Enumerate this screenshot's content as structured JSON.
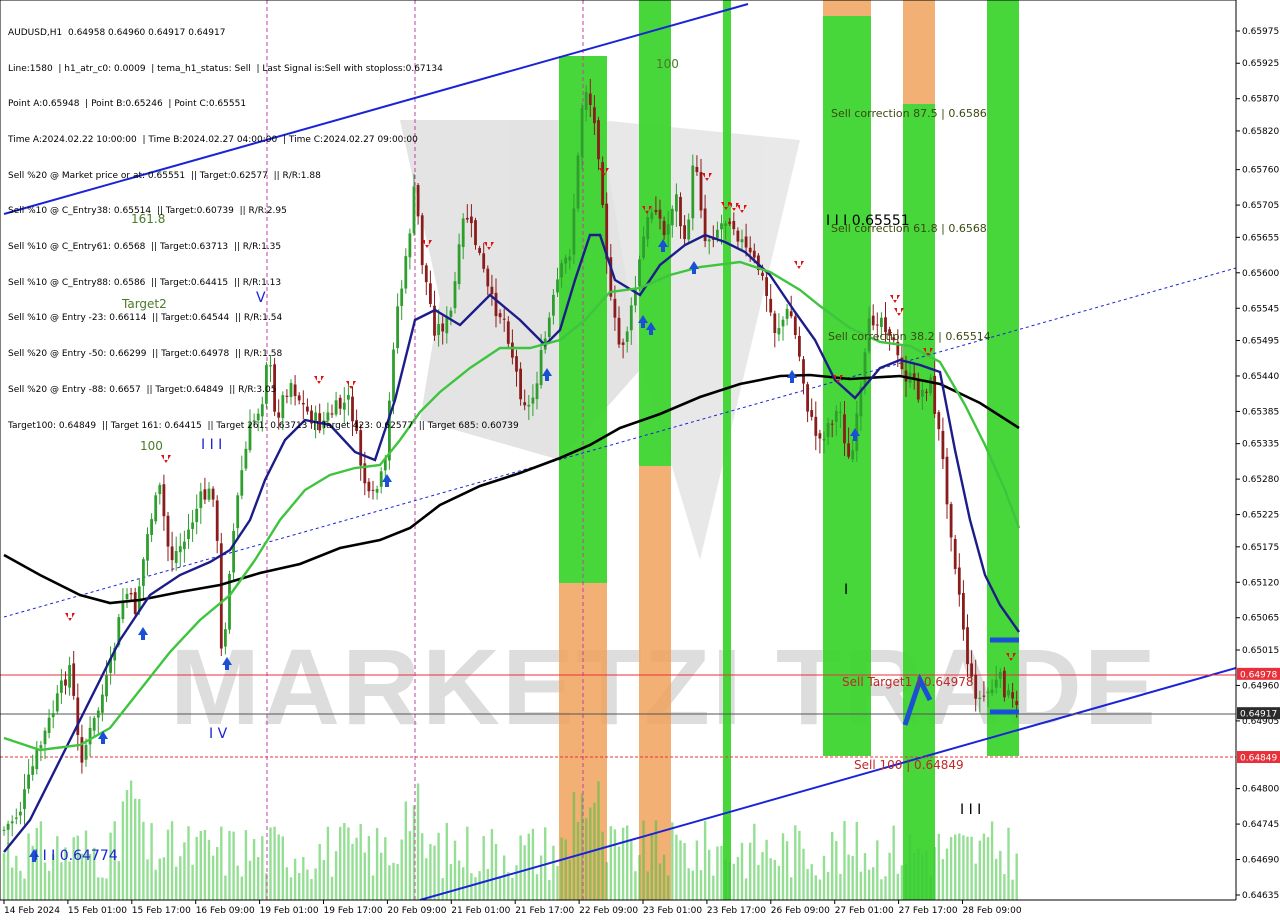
{
  "header": {
    "symbol_line": "AUDUSD,H1  0.64958 0.64960 0.64917 0.64917",
    "lines": [
      "Line:1580  | h1_atr_c0: 0.0009  | tema_h1_status: Sell  | Last Signal is:Sell with stoploss:0.67134",
      "Point A:0.65948  | Point B:0.65246  | Point C:0.65551",
      "Time A:2024.02.22 10:00:00  | Time B:2024.02.27 04:00:00  | Time C:2024.02.27 09:00:00",
      "Sell %20 @ Market price or at: 0.65551  || Target:0.62577  || R/R:1.88",
      "Sell %10 @ C_Entry38: 0.65514  || Target:0.60739  || R/R:2.95",
      "Sell %10 @ C_Entry61: 0.6568  || Target:0.63713  || R/R:1.35",
      "Sell %10 @ C_Entry88: 0.6586  || Target:0.64415  || R/R:1.13",
      "Sell %10 @ Entry -23: 0.66114  || Target:0.64544  || R/R:1.54",
      "Sell %20 @ Entry -50: 0.66299  || Target:0.64978  || R/R:1.58",
      "Sell %20 @ Entry -88: 0.6657  || Target:0.64849  || R/R:3.05",
      "Target100: 0.64849  || Target 161: 0.64415  || Target 261: 0.63713  || Target 423: 0.62577  || Target 685: 0.60739"
    ]
  },
  "watermark": "MARKETZI TRADE",
  "labels": {
    "t161": "161.8",
    "t2": "Target2",
    "t100a": "100",
    "t100b": "100",
    "III_a": "I I I",
    "V": "V",
    "IV": "I V",
    "III_b": "I I I",
    "I_mark": "I",
    "c_label": "I I I 0.65551",
    "start_label": "I I I 0.64774",
    "sell_corr_875": "Sell correction 87.5 | 0.6586",
    "sell_corr_618": "Sell correction 61.8 | 0.6568",
    "sell_corr_382": "Sell correction 38.2 | 0.65514",
    "sell_target1": "Sell Target1 | 0.64978",
    "sell_100": "Sell 100 | 0.64849"
  },
  "chart_data": {
    "type": "candlestick",
    "symbol": "AUDUSD",
    "timeframe": "H1",
    "ohlc_last": {
      "open": 0.64958,
      "high": 0.6496,
      "low": 0.64917,
      "close": 0.64917
    },
    "ylim": [
      0.64635,
      0.65985
    ],
    "y_ticks": [
      0.65975,
      0.65925,
      0.6587,
      0.6582,
      0.6576,
      0.65705,
      0.65655,
      0.656,
      0.65545,
      0.65495,
      0.6544,
      0.65385,
      0.65335,
      0.6528,
      0.65225,
      0.65175,
      0.6512,
      0.65065,
      0.65015,
      0.6496,
      0.64905,
      0.648,
      0.64745,
      0.6469,
      0.64635
    ],
    "x_ticks": [
      "14 Feb 2024",
      "15 Feb 01:00",
      "15 Feb 17:00",
      "16 Feb 09:00",
      "19 Feb 01:00",
      "19 Feb 17:00",
      "20 Feb 09:00",
      "21 Feb 01:00",
      "21 Feb 17:00",
      "22 Feb 09:00",
      "23 Feb 01:00",
      "23 Feb 17:00",
      "26 Feb 09:00",
      "27 Feb 01:00",
      "27 Feb 17:00",
      "28 Feb 09:00"
    ],
    "price_tags": [
      {
        "value": "0.64978",
        "color": "#e8303a",
        "text_color": "#ffffff"
      },
      {
        "value": "0.64917",
        "color": "#2b2b2b",
        "text_color": "#ffffff"
      },
      {
        "value": "0.64849",
        "color": "#e8303a",
        "text_color": "#ffffff"
      }
    ],
    "levels": {
      "point_a": 0.65948,
      "point_b": 0.65246,
      "point_c": 0.65551,
      "c_entry38": 0.65514,
      "c_entry61": 0.6568,
      "c_entry88": 0.6586,
      "target1": 0.64978,
      "target100": 0.64849,
      "stoploss": 0.67134
    },
    "colors": {
      "bull": "#2f9e2f",
      "bear": "#8a1c1c",
      "ema_slow": "#000000",
      "ema_mid": "#1c1c8a",
      "ema_green": "#3ec43e",
      "channel": "#1a24d6",
      "zone_green": "#37d42a",
      "zone_orange": "#f2a35a",
      "sell_arrow": "#e01010",
      "buy_arrow": "#1a4fd6"
    }
  }
}
